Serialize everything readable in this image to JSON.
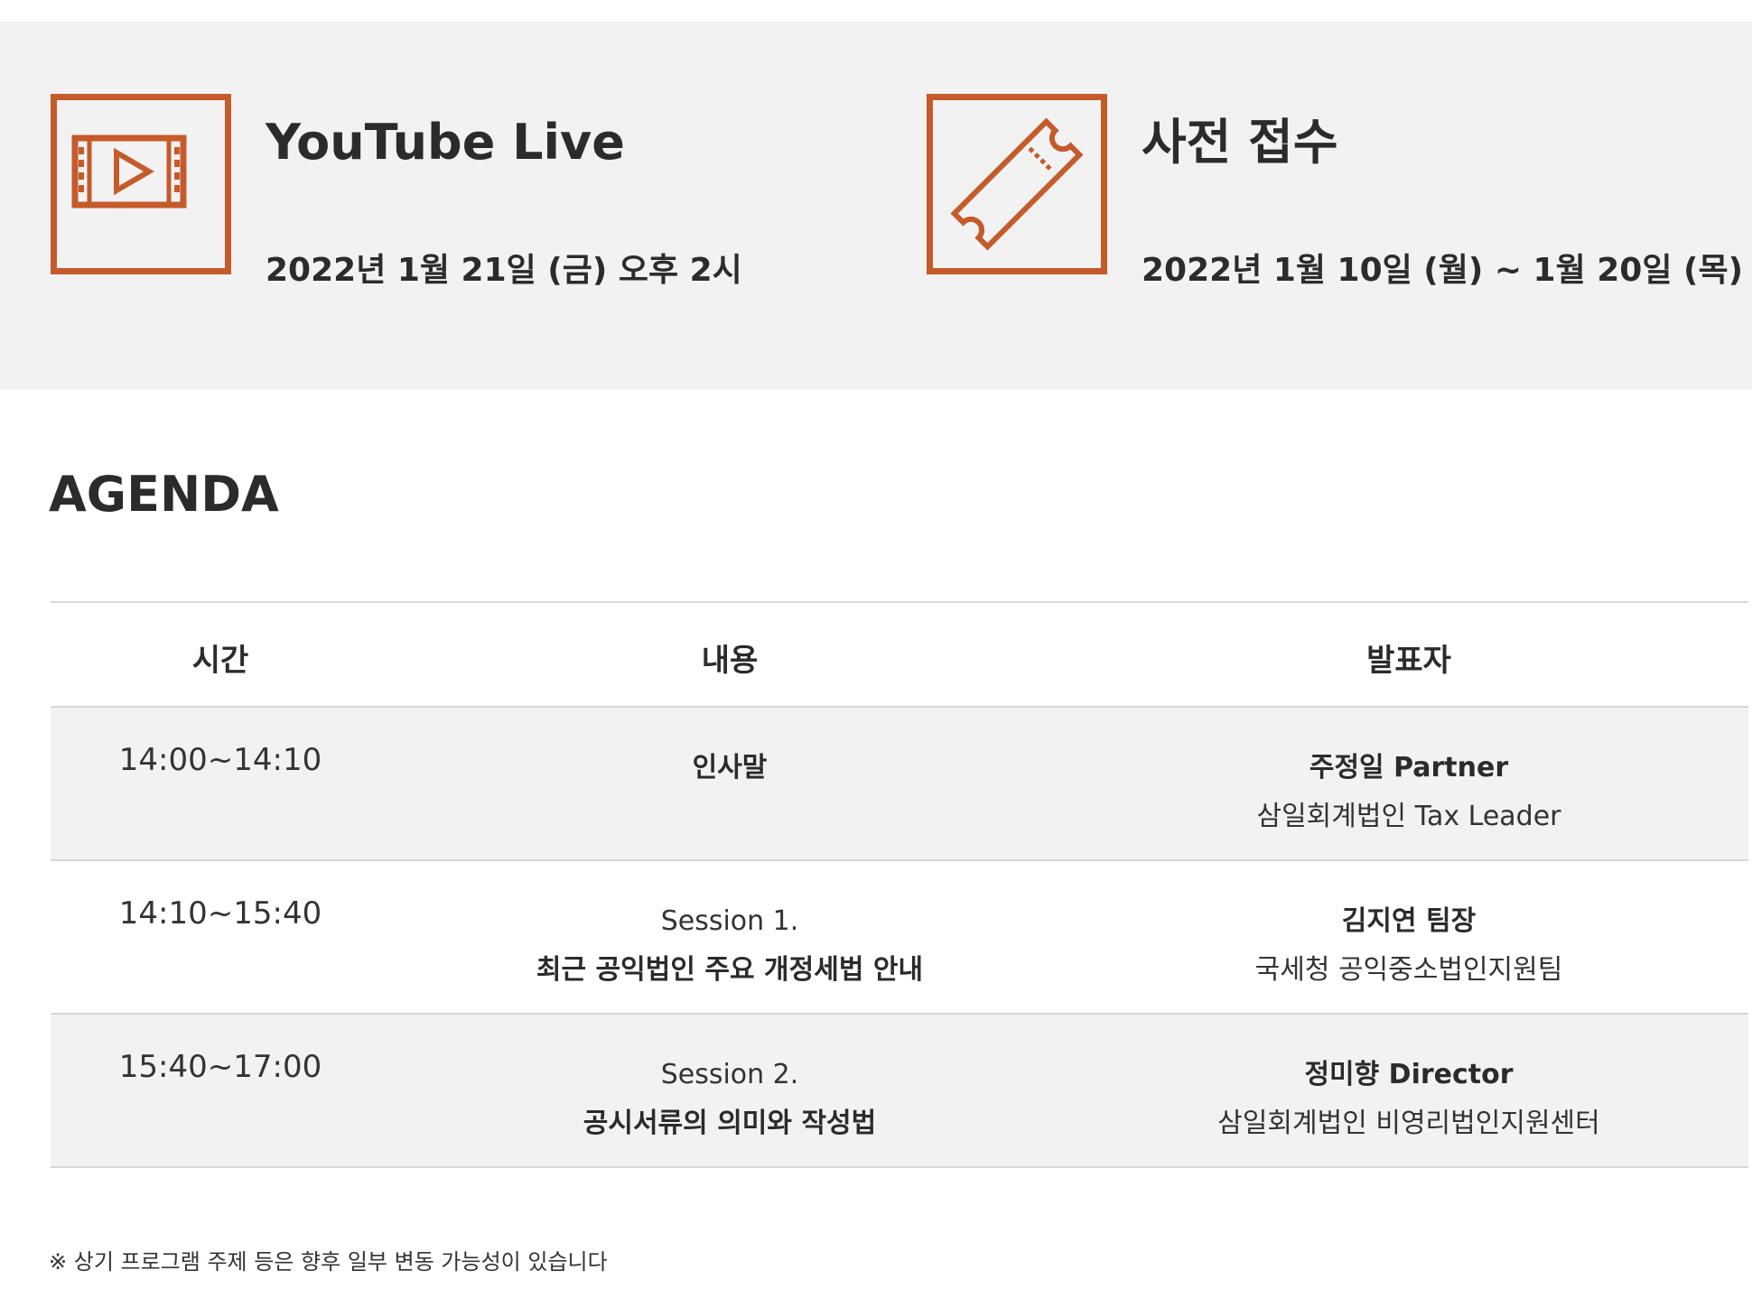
{
  "event": {
    "live": {
      "title": "YouTube Live",
      "date": "2022년 1월 21일 (금) 오후 2시",
      "icon": "video-play-icon"
    },
    "registration": {
      "title": "사전 접수",
      "date": "2022년 1월 10일 (월) ~ 1월 20일 (목)",
      "icon": "ticket-icon"
    }
  },
  "agenda": {
    "title": "AGENDA",
    "columns": [
      "시간",
      "내용",
      "발표자"
    ],
    "rows": [
      {
        "time": "14:00~14:10",
        "session": "",
        "content": "인사말",
        "speaker_name": "주정일 Partner",
        "speaker_org": "삼일회계법인 Tax Leader"
      },
      {
        "time": "14:10~15:40",
        "session": "Session 1.",
        "content": "최근 공익법인 주요 개정세법 안내",
        "speaker_name": "김지연 팀장",
        "speaker_org": "국세청 공익중소법인지원팀"
      },
      {
        "time": "15:40~17:00",
        "session": "Session 2.",
        "content": "공시서류의 의미와 작성법",
        "speaker_name": "정미향 Director",
        "speaker_org": "삼일회계법인 비영리법인지원센터"
      }
    ]
  },
  "footnote": "※ 상기 프로그램 주제 등은 향후 일부 변동 가능성이 있습니다",
  "colors": {
    "accent": "#c55a2b",
    "band_bg": "#f2f2f2",
    "divider": "#d6d6d6",
    "text": "#2b2b2b"
  }
}
